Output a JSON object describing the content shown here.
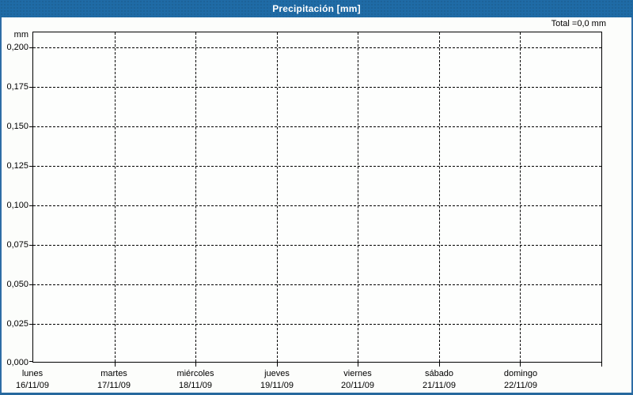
{
  "titlebar": {
    "title": "Precipitación [mm]"
  },
  "summary": {
    "total_label": "Total =0,0 mm"
  },
  "y_axis": {
    "unit": "mm",
    "ticks": [
      "0,200",
      "0,175",
      "0,150",
      "0,125",
      "0,100",
      "0,075",
      "0,050",
      "0,025",
      "0,000"
    ]
  },
  "x_axis": {
    "days": [
      {
        "name": "lunes",
        "date": "16/11/09"
      },
      {
        "name": "martes",
        "date": "17/11/09"
      },
      {
        "name": "miércoles",
        "date": "18/11/09"
      },
      {
        "name": "jueves",
        "date": "19/11/09"
      },
      {
        "name": "viernes",
        "date": "20/11/09"
      },
      {
        "name": "sábado",
        "date": "21/11/09"
      },
      {
        "name": "domingo",
        "date": "22/11/09"
      }
    ]
  },
  "colors": {
    "titlebar_bg": "#1F6BA6",
    "frame_border": "#2E6DA6",
    "plot_border": "#000000",
    "background": "#FCFDFB",
    "title_text": "#FFFFFF",
    "label_text": "#000000"
  },
  "chart_data": {
    "type": "bar",
    "title": "Precipitación [mm]",
    "categories": [
      "lunes 16/11/09",
      "martes 17/11/09",
      "miércoles 18/11/09",
      "jueves 19/11/09",
      "viernes 20/11/09",
      "sábado 21/11/09",
      "domingo 22/11/09"
    ],
    "values": [
      0,
      0,
      0,
      0,
      0,
      0,
      0
    ],
    "total_annotation": "Total =0,0 mm",
    "xlabel": "",
    "ylabel": "mm",
    "ylim": [
      0,
      0.21
    ],
    "yticks": [
      0.0,
      0.025,
      0.05,
      0.075,
      0.1,
      0.125,
      0.15,
      0.175,
      0.2
    ],
    "y_decimal_separator": ",",
    "grid": true,
    "legend": false
  }
}
